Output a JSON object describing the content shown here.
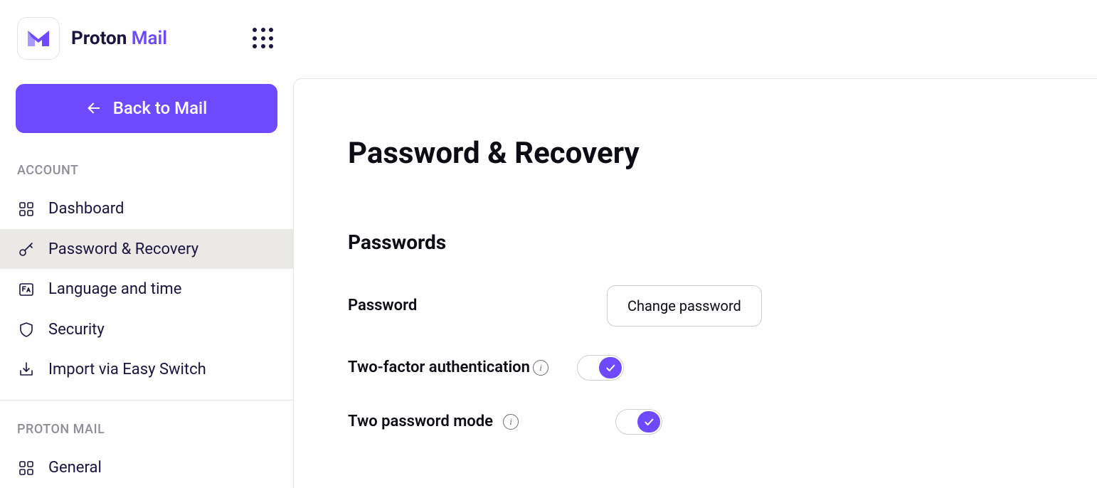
{
  "header": {
    "brand_primary": "Proton",
    "brand_secondary": "Mail"
  },
  "sidebar": {
    "back_label": "Back to Mail",
    "account_section": "ACCOUNT",
    "protonmail_section": "PROTON MAIL",
    "items": {
      "dashboard": "Dashboard",
      "password_recovery": "Password & Recovery",
      "language_time": "Language and time",
      "security": "Security",
      "import_easy_switch": "Import via Easy Switch",
      "general": "General"
    }
  },
  "main": {
    "title": "Password & Recovery",
    "passwords_section": "Passwords",
    "password_label": "Password",
    "change_password_btn": "Change password",
    "two_factor_label": "Two-factor authentication",
    "two_password_label": "Two password mode"
  }
}
